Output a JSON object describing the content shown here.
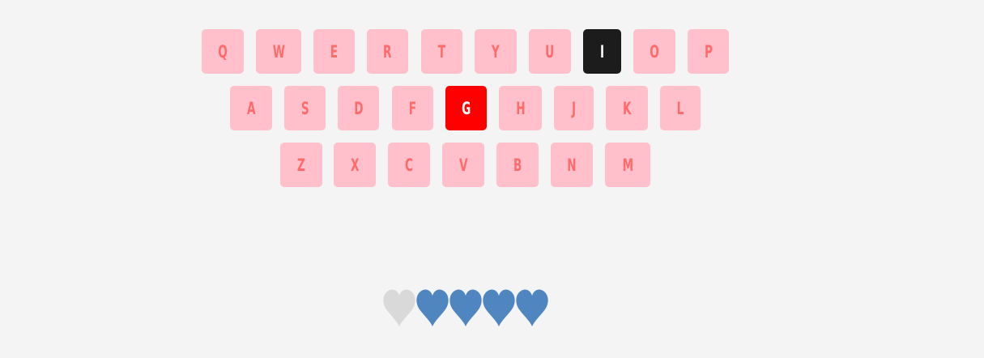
{
  "keyboard": {
    "rows": [
      [
        {
          "letter": "Q",
          "state": "unused"
        },
        {
          "letter": "W",
          "state": "unused"
        },
        {
          "letter": "E",
          "state": "unused"
        },
        {
          "letter": "R",
          "state": "unused"
        },
        {
          "letter": "T",
          "state": "unused"
        },
        {
          "letter": "Y",
          "state": "unused"
        },
        {
          "letter": "U",
          "state": "unused"
        },
        {
          "letter": "I",
          "state": "correct"
        },
        {
          "letter": "O",
          "state": "unused"
        },
        {
          "letter": "P",
          "state": "unused"
        }
      ],
      [
        {
          "letter": "A",
          "state": "unused"
        },
        {
          "letter": "S",
          "state": "unused"
        },
        {
          "letter": "D",
          "state": "unused"
        },
        {
          "letter": "F",
          "state": "unused"
        },
        {
          "letter": "G",
          "state": "wrong"
        },
        {
          "letter": "H",
          "state": "unused"
        },
        {
          "letter": "J",
          "state": "unused"
        },
        {
          "letter": "K",
          "state": "unused"
        },
        {
          "letter": "L",
          "state": "unused"
        }
      ],
      [
        {
          "letter": "Z",
          "state": "unused"
        },
        {
          "letter": "X",
          "state": "unused"
        },
        {
          "letter": "C",
          "state": "unused"
        },
        {
          "letter": "V",
          "state": "unused"
        },
        {
          "letter": "B",
          "state": "unused"
        },
        {
          "letter": "N",
          "state": "unused"
        },
        {
          "letter": "M",
          "state": "unused"
        }
      ]
    ]
  },
  "lives": {
    "total": 5,
    "remaining": 4,
    "icon": "heart-icon",
    "colors": {
      "full": "#4f86c0",
      "lost": "#d9d9d9"
    }
  },
  "colors": {
    "background": "#f4f4f4",
    "key_unused_bg": "#ffc0cb",
    "key_unused_text": "#ff6b6b",
    "key_wrong_bg": "#ff0000",
    "key_correct_bg": "#1c1c1c"
  }
}
